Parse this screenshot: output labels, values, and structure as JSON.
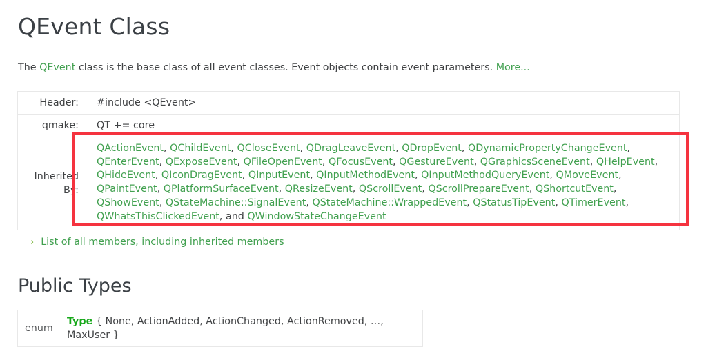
{
  "page": {
    "title": "QEvent Class",
    "brief": {
      "prefix": "The ",
      "class_link": "QEvent",
      "middle": " class is the base class of all event classes. Event objects contain event parameters. ",
      "more_link": "More..."
    }
  },
  "info_table": {
    "rows": [
      {
        "label": "Header:",
        "value": "#include <QEvent>"
      },
      {
        "label": "qmake:",
        "value": "QT += core"
      }
    ],
    "inherited_by": {
      "label_line1": "Inherited",
      "label_line2": "By:",
      "classes": [
        "QActionEvent",
        "QChildEvent",
        "QCloseEvent",
        "QDragLeaveEvent",
        "QDropEvent",
        "QDynamicPropertyChangeEvent",
        "QEnterEvent",
        "QExposeEvent",
        "QFileOpenEvent",
        "QFocusEvent",
        "QGestureEvent",
        "QGraphicsSceneEvent",
        "QHelpEvent",
        "QHideEvent",
        "QIconDragEvent",
        "QInputEvent",
        "QInputMethodEvent",
        "QInputMethodQueryEvent",
        "QMoveEvent",
        "QPaintEvent",
        "QPlatformSurfaceEvent",
        "QResizeEvent",
        "QScrollEvent",
        "QScrollPrepareEvent",
        "QShortcutEvent",
        "QShowEvent",
        "QStateMachine::SignalEvent",
        "QStateMachine::WrappedEvent",
        "QStatusTipEvent",
        "QTimerEvent",
        "QWhatsThisClickedEvent",
        "QWindowStateChangeEvent"
      ],
      "conjunction": "and",
      "separator": ", "
    }
  },
  "members_link": {
    "chevron": "›",
    "label": "List of all members, including inherited members"
  },
  "public_types": {
    "heading": "Public Types",
    "rows": [
      {
        "kind": "enum",
        "name": "Type",
        "declaration": " { None, ActionAdded, ActionChanged, ActionRemoved, …, MaxUser }"
      }
    ]
  },
  "annotation": {
    "shape": "rectangle",
    "color": "#f5333f"
  },
  "colors": {
    "link_green": "#41a04f",
    "strong_green": "#17a81a",
    "text": "#404244",
    "heading": "#3b4045",
    "table_border": "#e8e8e8",
    "annotation_red": "#f5333f"
  }
}
